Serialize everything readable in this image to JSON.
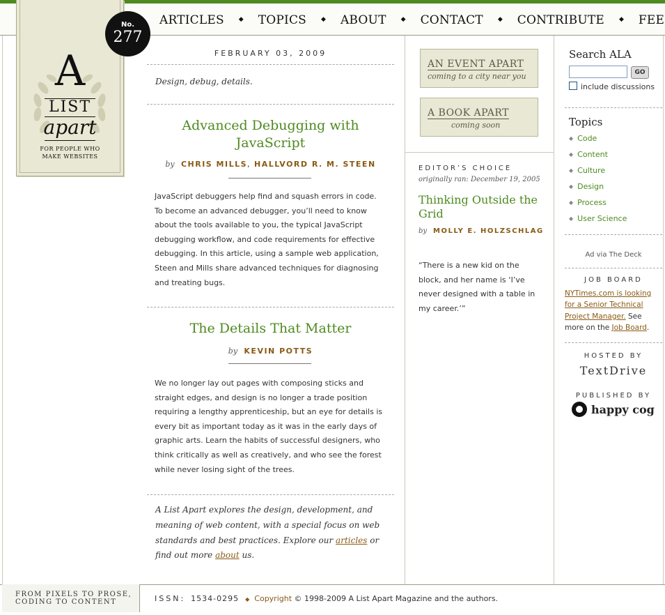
{
  "nav": {
    "items": [
      "ARTICLES",
      "TOPICS",
      "ABOUT",
      "CONTACT",
      "CONTRIBUTE",
      "FEED"
    ]
  },
  "logo": {
    "letter": "A",
    "list": "LIST",
    "apart": "apart",
    "tagline_1": "FOR PEOPLE WHO",
    "tagline_2": "MAKE WEBSITES"
  },
  "issue": {
    "label": "No.",
    "number": "277"
  },
  "main": {
    "date": "FEBRUARY 03, 2009",
    "tagline": "Design, debug, details.",
    "articles": [
      {
        "title": "Advanced Debugging with JavaScript",
        "by": "by",
        "authors": [
          "CHRIS MILLS",
          "HALLVORD R. M. STEEN"
        ],
        "summary": "JavaScript debuggers help find and squash errors in code. To become an advanced debugger, you’ll need to know about the tools available to you, the typical JavaScript debugging workflow, and code requirements for effective debugging. In this article, using a sample web application, Steen and Mills share advanced techniques for diagnosing and treating bugs."
      },
      {
        "title": "The Details That Matter",
        "by": "by",
        "authors": [
          "KEVIN POTTS"
        ],
        "summary": "We no longer lay out pages with composing sticks and straight edges, and design is no longer a trade position requiring a lengthy apprenticeship, but an eye for details is every bit as important today as it was in the early days of graphic arts. Learn the habits of successful designers, who think critically as well as creatively, and who see the forest while never losing sight of the trees."
      }
    ],
    "explore": {
      "text_1": "A List Apart explores the design, development, and meaning of web content, with a special focus on web standards and best practices. Explore our ",
      "link_articles": "articles",
      "text_2": " or find out more ",
      "link_about": "about",
      "text_3": " us."
    }
  },
  "middle": {
    "promos": [
      {
        "line1": "AN EVENT APART",
        "line2": "coming to a city near you"
      },
      {
        "line1": "A BOOK APART",
        "line2": "coming soon"
      }
    ],
    "editors_choice": {
      "heading": "EDITOR’S CHOICE",
      "originally_ran": "originally ran: December 19, 2005",
      "title": "Thinking Outside the Grid",
      "by": "by",
      "author": "MOLLY E. HOLZSCHLAG",
      "quote": "“There is a new kid on the block, and her name is ‘I’ve never designed with a table in my career.’”"
    }
  },
  "sidebar": {
    "search_heading": "Search ALA",
    "search_value": "",
    "go_label": "GO",
    "include_label": "include discussions",
    "topics_heading": "Topics",
    "topics": [
      "Code",
      "Content",
      "Culture",
      "Design",
      "Process",
      "User Science"
    ],
    "ad_text": "Ad via The Deck",
    "job_heading": "JOB BOARD",
    "job_link": "NYTimes.com is looking for a Senior Technical Project Manager.",
    "job_text": " See more on the ",
    "job_board_link": "Job Board",
    "job_end": ".",
    "hosted_heading": "HOSTED BY",
    "hosted_name": "TextDrive",
    "published_heading": "PUBLISHED BY",
    "published_name": "happy cog"
  },
  "footer": {
    "motto_1": "FROM PIXELS TO PROSE,",
    "motto_2": "CODING TO CONTENT",
    "issn_label": "ISSN:",
    "issn_value": "1534-0295",
    "copyright_link": "Copyright",
    "copyright_text": " © 1998-2009 A List Apart Magazine and the authors."
  },
  "colors": {
    "accent_green": "#4d8a1f",
    "byline_brown": "#8a5a14",
    "logo_paper": "#e9e8d4"
  }
}
